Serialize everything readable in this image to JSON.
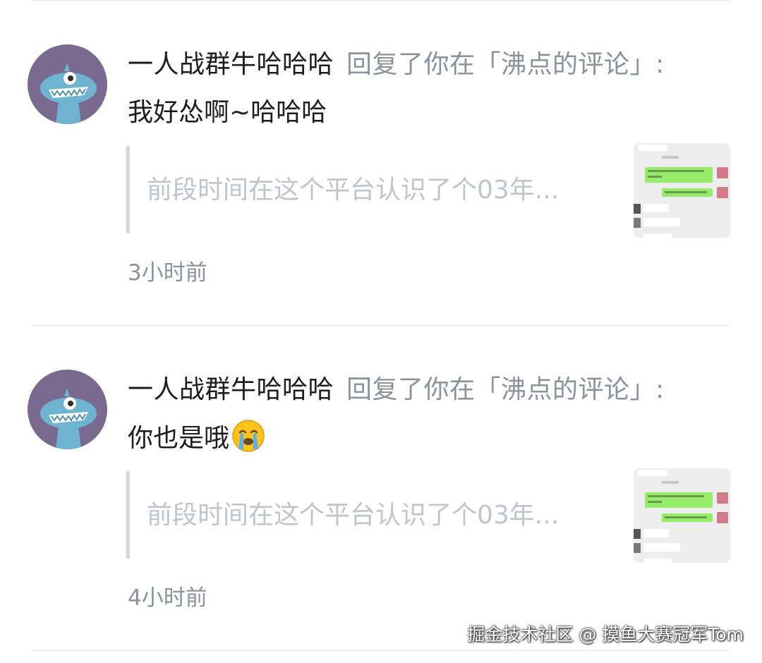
{
  "colors": {
    "avatar_bg": "#7b6a8f",
    "monster": "#6eb3cf",
    "name": "#1d1d1f",
    "meta": "#8a919f",
    "quote": "#c0c4cc"
  },
  "notifications": [
    {
      "user_name": "一人战群牛哈哈哈",
      "action_text": "回复了你在「沸点的评论」:",
      "comment": "我好怂啊~哈哈哈",
      "emoji": null,
      "quote": "前段时间在这个平台认识了个03年...",
      "time": "3小时前"
    },
    {
      "user_name": "一人战群牛哈哈哈",
      "action_text": "回复了你在「沸点的评论」:",
      "comment": "你也是哦",
      "emoji": "crying-face-icon",
      "quote": "前段时间在这个平台认识了个03年...",
      "time": "4小时前"
    }
  ],
  "watermark": "掘金技术社区 @ 摸鱼大赛冠军Tom"
}
